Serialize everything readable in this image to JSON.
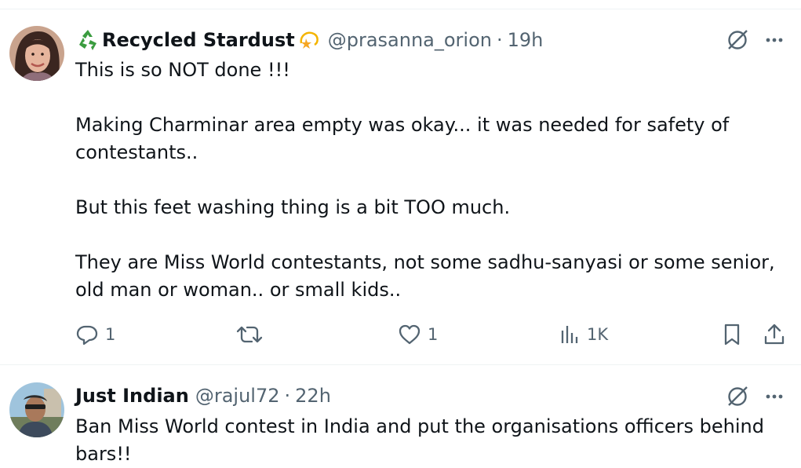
{
  "posts": [
    {
      "display_name": "Recycled Stardust",
      "badge_left": "recycle-icon",
      "badge_right": "dizzy-star-icon",
      "handle": "@prasanna_orion",
      "separator": "·",
      "time": "19h",
      "paragraphs": [
        "This is so NOT done !!!",
        "Making Charminar area empty was okay... it was needed for safety of contestants..",
        "But this feet washing thing is a bit TOO much.",
        "They are Miss World contestants, not some sadhu-sanyasi or some senior, old man or woman.. or small kids.."
      ],
      "actions": {
        "replies": "1",
        "reposts": "",
        "likes": "1",
        "views": "1K"
      }
    },
    {
      "display_name": "Just Indian",
      "handle": "@rajul72",
      "separator": "·",
      "time": "22h",
      "paragraphs": [
        "Ban Miss World contest in India and put the organisations officers behind bars!!"
      ]
    }
  ],
  "colors": {
    "text": "#0f1419",
    "secondary": "#536471",
    "divider": "#eff3f4"
  }
}
